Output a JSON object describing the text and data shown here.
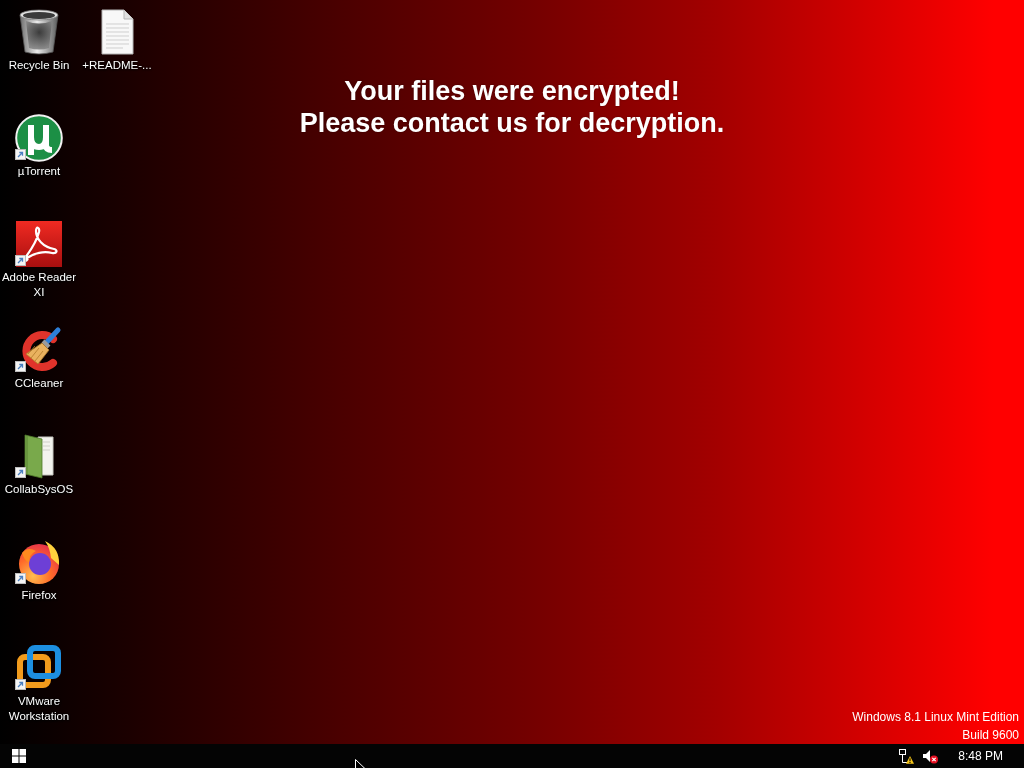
{
  "desktop": {
    "icons": [
      {
        "label": "Recycle Bin",
        "shortcut": false
      },
      {
        "label": "µTorrent",
        "shortcut": true
      },
      {
        "label": "Adobe Reader XI",
        "shortcut": true
      },
      {
        "label": "CCleaner",
        "shortcut": true
      },
      {
        "label": "CollabSysOS",
        "shortcut": true
      },
      {
        "label": "Firefox",
        "shortcut": true
      },
      {
        "label": "VMware Workstation",
        "shortcut": true
      },
      {
        "label": "+README-...",
        "shortcut": false
      }
    ],
    "message": [
      "Your files were encrypted!",
      "Please contact us for decryption."
    ],
    "version_text": [
      "Windows 8.1 Linux Mint Edition",
      "Build 9600"
    ]
  },
  "taskbar": {
    "tray_icons": [
      {
        "kind": "network",
        "warning": true
      },
      {
        "kind": "volume",
        "muted": true
      }
    ],
    "clock": "8:48 PM"
  }
}
